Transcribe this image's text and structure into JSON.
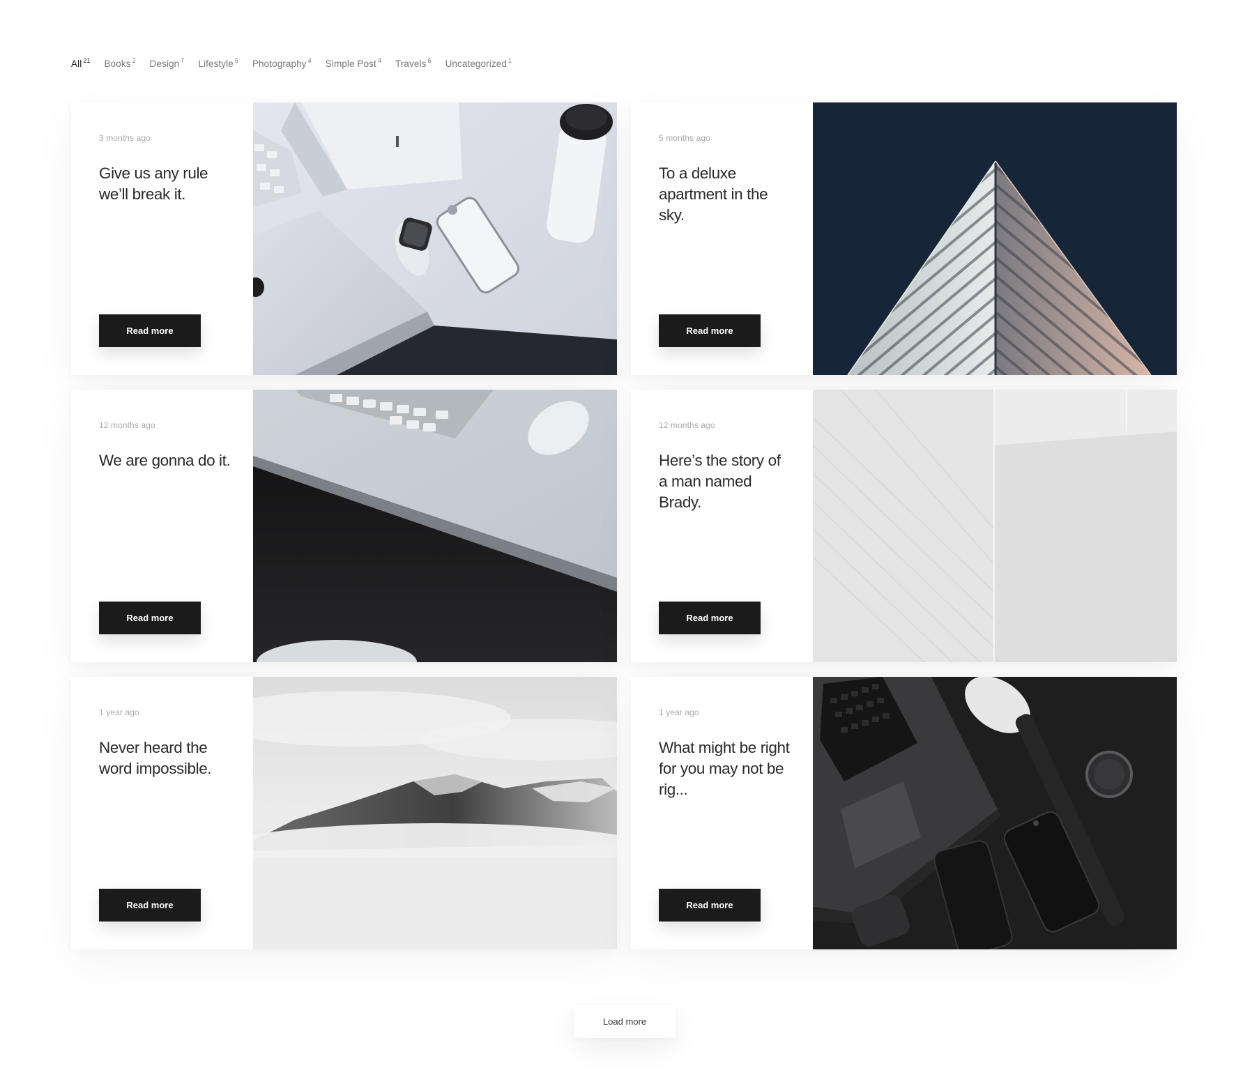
{
  "filters": [
    {
      "label": "All",
      "count": "21",
      "active": true
    },
    {
      "label": "Books",
      "count": "2",
      "active": false
    },
    {
      "label": "Design",
      "count": "7",
      "active": false
    },
    {
      "label": "Lifestyle",
      "count": "5",
      "active": false
    },
    {
      "label": "Photography",
      "count": "4",
      "active": false
    },
    {
      "label": "Simple Post",
      "count": "4",
      "active": false
    },
    {
      "label": "Travels",
      "count": "6",
      "active": false
    },
    {
      "label": "Uncategorized",
      "count": "1",
      "active": false
    }
  ],
  "posts": [
    {
      "date": "3 months ago",
      "title": "Give us any rule we’ll break it.",
      "button": "Read more",
      "image": "desk-watch-phone-photo"
    },
    {
      "date": "5 months ago",
      "title": "To a deluxe apartment in the sky.",
      "button": "Read more",
      "image": "skyscraper-corner-photo"
    },
    {
      "date": "12 months ago",
      "title": "We are gonna do it.",
      "button": "Read more",
      "image": "keyboard-mouse-desk-photo"
    },
    {
      "date": "12 months ago",
      "title": "Here’s the story of a man named Brady.",
      "button": "Read more",
      "image": "white-architecture-photo"
    },
    {
      "date": "1 year ago",
      "title": "Never heard the word impossible.",
      "button": "Read more",
      "image": "misty-mountain-photo"
    },
    {
      "date": "1 year ago",
      "title": "What might be right for you may not be rig...",
      "button": "Read more",
      "image": "dark-laptop-phones-photo"
    }
  ],
  "load_more": {
    "label": "Load more"
  },
  "colors": {
    "button_bg": "#1b1b1b",
    "button_text": "#ffffff",
    "page_bg": "#ffffff"
  }
}
